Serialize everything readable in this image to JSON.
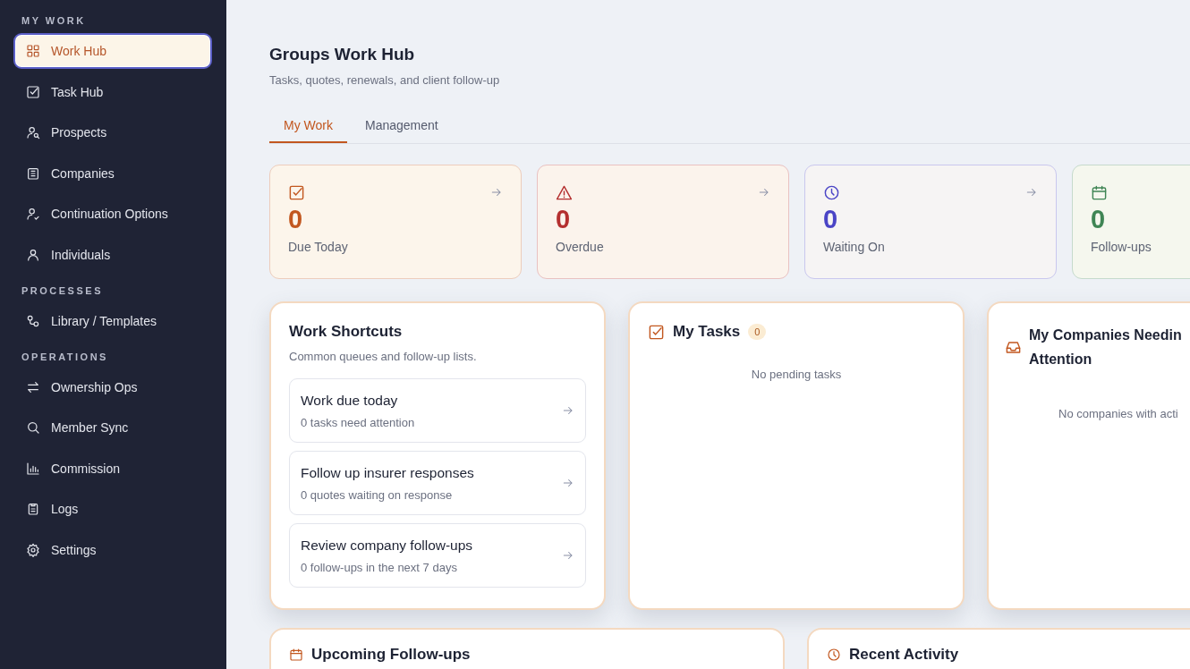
{
  "sidebar": {
    "sections": [
      {
        "heading": "MY WORK",
        "items": [
          {
            "label": "Work Hub",
            "selected": true
          },
          {
            "label": "Task Hub",
            "selected": false
          },
          {
            "label": "Prospects",
            "selected": false
          },
          {
            "label": "Companies",
            "selected": false
          },
          {
            "label": "Continuation Options",
            "selected": false
          },
          {
            "label": "Individuals",
            "selected": false
          }
        ]
      },
      {
        "heading": "PROCESSES",
        "items": [
          {
            "label": "Library / Templates",
            "selected": false
          }
        ]
      },
      {
        "heading": "OPERATIONS",
        "items": [
          {
            "label": "Ownership Ops",
            "selected": false
          },
          {
            "label": "Member Sync",
            "selected": false
          },
          {
            "label": "Commission",
            "selected": false
          },
          {
            "label": "Logs",
            "selected": false
          },
          {
            "label": "Settings",
            "selected": false
          }
        ]
      }
    ]
  },
  "header": {
    "title": "Groups Work Hub",
    "subtitle": "Tasks, quotes, renewals, and client follow-up"
  },
  "tabs": [
    {
      "label": "My Work",
      "selected": true
    },
    {
      "label": "Management",
      "selected": false
    }
  ],
  "stats": [
    {
      "value": "0",
      "label": "Due Today",
      "color": "#c2571f",
      "arrow": true
    },
    {
      "value": "0",
      "label": "Overdue",
      "color": "#b42f2f",
      "arrow": true
    },
    {
      "value": "0",
      "label": "Waiting On",
      "color": "#4a44c6",
      "arrow": true
    },
    {
      "value": "0",
      "label": "Follow-ups",
      "color": "#3f8554",
      "arrow": false
    }
  ],
  "shortcuts": {
    "title": "Work Shortcuts",
    "subtitle": "Common queues and follow-up lists.",
    "items": [
      {
        "title": "Work due today",
        "subtitle": "0 tasks need attention"
      },
      {
        "title": "Follow up insurer responses",
        "subtitle": "0 quotes waiting on response"
      },
      {
        "title": "Review company follow-ups",
        "subtitle": "0 follow-ups in the next 7 days"
      }
    ]
  },
  "tasks": {
    "title": "My Tasks",
    "count": "0",
    "empty": "No pending tasks"
  },
  "companies": {
    "title_lines": [
      "My Companies Needin",
      "Attention"
    ],
    "empty": "No companies with acti"
  },
  "bottom_panels": [
    {
      "title": "Upcoming Follow-ups"
    },
    {
      "title": "Recent Activity"
    }
  ]
}
